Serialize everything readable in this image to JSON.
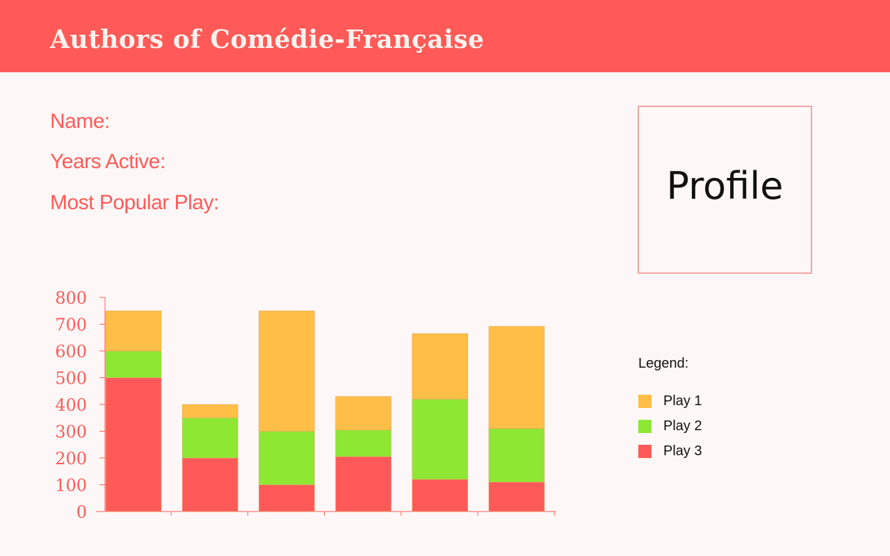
{
  "header": {
    "title": "Authors of Comédie-Française"
  },
  "fields": {
    "name_label": "Name:",
    "years_label": "Years Active:",
    "play_label": "Most Popular Play:"
  },
  "profile": {
    "label": "Profile"
  },
  "legend": {
    "title": "Legend:",
    "items": [
      {
        "label": "Play 1",
        "color": "#ffbe45"
      },
      {
        "label": "Play 2",
        "color": "#8de733"
      },
      {
        "label": "Play 3",
        "color": "#ff5a57"
      }
    ]
  },
  "colors": {
    "accent": "#ff5a57",
    "background": "#fdf8f7",
    "profile_border": "#f4a3a1"
  },
  "chart_data": {
    "type": "bar",
    "stacked": true,
    "categories": [
      "",
      "",
      "",
      "",
      "",
      ""
    ],
    "series": [
      {
        "name": "Play 3",
        "color": "#ff5a57",
        "values": [
          500,
          200,
          100,
          205,
          120,
          110
        ]
      },
      {
        "name": "Play 2",
        "color": "#8de733",
        "values": [
          100,
          150,
          200,
          100,
          300,
          200
        ]
      },
      {
        "name": "Play 1",
        "color": "#ffbe45",
        "values": [
          150,
          50,
          450,
          125,
          245,
          382
        ]
      }
    ],
    "yticks": [
      "0",
      "100",
      "200",
      "300",
      "400",
      "500",
      "600",
      "700",
      "800"
    ],
    "ylim": [
      0,
      800
    ],
    "grid": false,
    "legend_position": "right"
  }
}
